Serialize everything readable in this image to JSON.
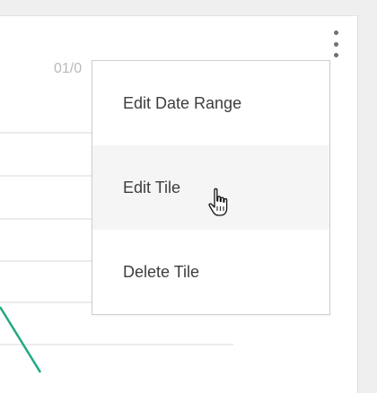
{
  "tile": {
    "date_label": "01/0",
    "menu_icon": "more-vertical-icon"
  },
  "menu": {
    "items": [
      {
        "label": "Edit Date Range"
      },
      {
        "label": "Edit Tile"
      },
      {
        "label": "Delete Tile"
      }
    ]
  },
  "cursor": {
    "icon": "hand-pointer-icon"
  },
  "colors": {
    "line_series": "#22a884",
    "gridline": "#e6e6e6",
    "tile_background": "#ffffff",
    "page_background": "#efefef"
  }
}
